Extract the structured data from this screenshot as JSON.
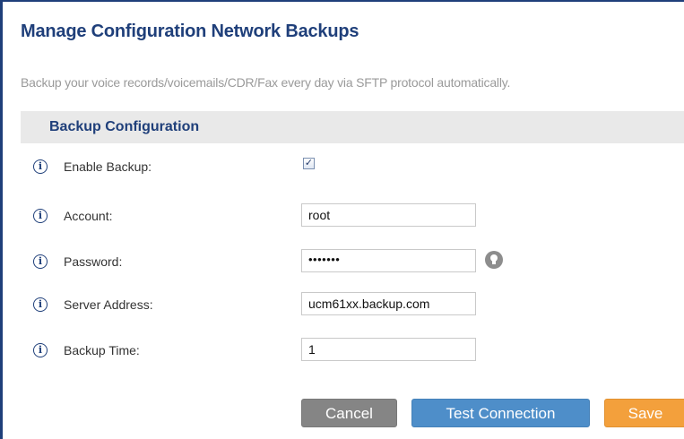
{
  "page": {
    "title": "Manage Configuration Network Backups",
    "description": "Backup your voice records/voicemails/CDR/Fax every day via SFTP protocol automatically."
  },
  "section": {
    "title": "Backup Configuration"
  },
  "form": {
    "enable_backup": {
      "label": "Enable Backup:",
      "checked": true,
      "check_glyph": "✓"
    },
    "account": {
      "label": "Account:",
      "value": "root"
    },
    "password": {
      "label": "Password:",
      "value": "•••••••"
    },
    "server_address": {
      "label": "Server Address:",
      "value": "ucm61xx.backup.com"
    },
    "backup_time": {
      "label": "Backup Time:",
      "value": "1"
    },
    "info_glyph": "i"
  },
  "buttons": {
    "cancel": "Cancel",
    "test_connection": "Test Connection",
    "save": "Save"
  },
  "icons": {
    "info": "info-circle-icon",
    "password_hint": "lightbulb-icon"
  },
  "colors": {
    "title": "#1f3f7a",
    "section_bar": "#e9e9e9",
    "cancel_button": "#858585",
    "test_button": "#4e8ec9",
    "save_button": "#f3a03c"
  }
}
